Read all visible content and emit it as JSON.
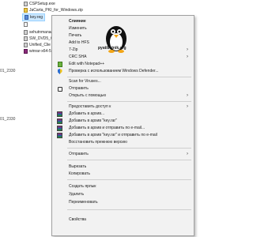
{
  "explorer": {
    "files": [
      {
        "name": "CSPSetup.exe",
        "icon": "exe-icon"
      },
      {
        "name": "JaCarta_PKI_for_Windows.zip",
        "icon": "zip-icon"
      },
      {
        "name": "key.reg",
        "icon": "reg-file-icon",
        "selected": true
      },
      {
        "name": "",
        "icon": "file-icon"
      },
      {
        "name": "sehutnmanag",
        "icon": "exe-icon"
      },
      {
        "name": "SW_DVD5_O",
        "icon": "exe-icon"
      },
      {
        "name": "Unified_Clie",
        "icon": "exe-icon"
      },
      {
        "name": "winrar-x64-5",
        "icon": "rar-icon"
      }
    ],
    "side_labels": [
      "01_2330",
      "01_2330"
    ]
  },
  "watermark": "pyatilistnik.org",
  "menu": {
    "items": [
      {
        "label": "Слияние",
        "bold": true
      },
      {
        "label": "Изменить"
      },
      {
        "label": "Печать"
      },
      {
        "label": "Add to HFS"
      },
      {
        "label": "7-Zip",
        "submenu": true
      },
      {
        "label": "CRC SHA",
        "submenu": true
      },
      {
        "label": "Edit with Notepad++",
        "icon": "notepad-plus-plus-icon"
      },
      {
        "label": "Проверка с использованием Windows Defender...",
        "icon": "windows-defender-icon"
      },
      {
        "label": "Scan for Viruses..."
      },
      {
        "label": "Отправить",
        "icon": "share-icon"
      },
      {
        "label": "Открыть с помощью",
        "submenu": true
      },
      {
        "label": "Предоставить доступ к",
        "submenu": true
      },
      {
        "label": "Добавить в архив...",
        "icon": "winrar-icon"
      },
      {
        "label": "Добавить в архив \"key.rar\"",
        "icon": "winrar-icon"
      },
      {
        "label": "Добавить в архив и отправить по e-mail...",
        "icon": "winrar-icon"
      },
      {
        "label": "Добавить в архив \"key.rar\" и отправить по e-mail",
        "icon": "winrar-icon"
      },
      {
        "label": "Восстановить прежнюю версию"
      },
      {
        "label": "Отправить",
        "submenu": true
      },
      {
        "label": "Вырезать"
      },
      {
        "label": "Копировать"
      },
      {
        "label": "Создать ярлык"
      },
      {
        "label": "Удалить"
      },
      {
        "label": "Переименовать"
      },
      {
        "label": "Свойства"
      }
    ]
  }
}
